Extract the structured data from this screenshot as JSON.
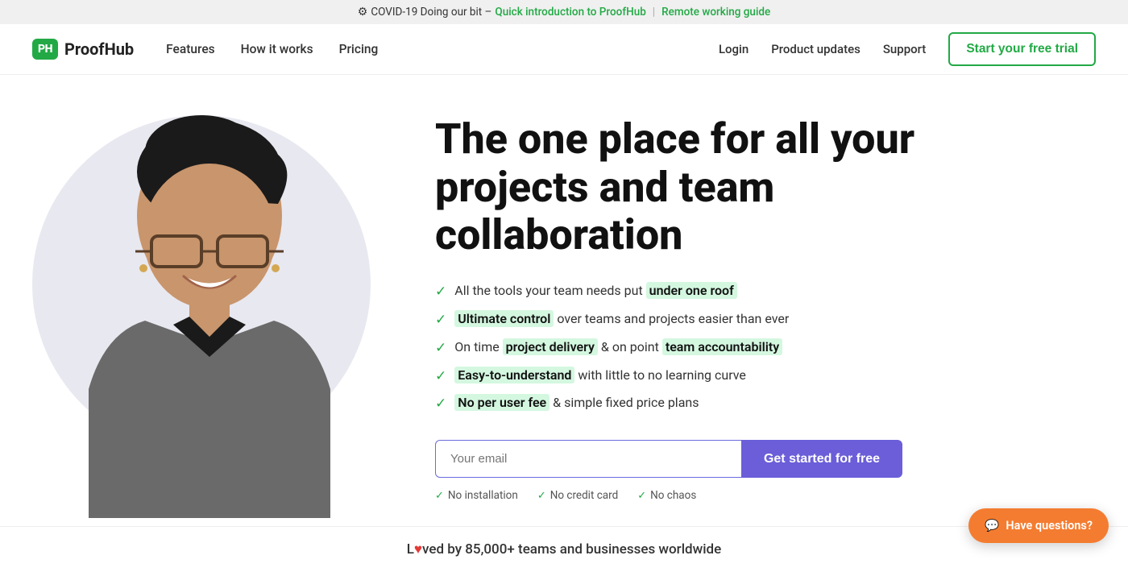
{
  "banner": {
    "gear": "⚙",
    "text": "COVID-19 Doing our bit –",
    "link1_text": "Quick introduction to ProofHub",
    "separator": "|",
    "link2_text": "Remote working guide"
  },
  "nav": {
    "logo_short": "PH",
    "logo_full": "ProofHub",
    "links": [
      {
        "label": "Features"
      },
      {
        "label": "How it works"
      },
      {
        "label": "Pricing"
      }
    ],
    "right_links": [
      {
        "label": "Login"
      },
      {
        "label": "Product updates"
      },
      {
        "label": "Support"
      }
    ],
    "cta": "Start your free trial"
  },
  "hero": {
    "title": "The one place for all your projects and team collaboration",
    "features": [
      {
        "text_before": "All the tools your team needs put ",
        "highlight": "under one roof",
        "text_after": ""
      },
      {
        "text_before": "",
        "highlight": "Ultimate control",
        "text_after": " over teams and projects easier than ever"
      },
      {
        "text_before": "On time ",
        "highlight": "project delivery",
        "text_mid": " & on point ",
        "highlight2": "team accountability",
        "text_after": ""
      },
      {
        "text_before": "",
        "highlight": "Easy-to-understand",
        "text_after": " with little to no learning curve"
      },
      {
        "text_before": "",
        "highlight": "No per user fee",
        "text_after": " & simple fixed price plans"
      }
    ],
    "email_placeholder": "Your email",
    "cta_button": "Get started for free",
    "no_items": [
      "No installation",
      "No credit card",
      "No chaos"
    ]
  },
  "loved_bar": {
    "text_before": "L",
    "heart": "♥",
    "text_after": "ved by 85,000+ teams and businesses worldwide"
  },
  "chat": {
    "icon": "💬",
    "label": "Have questions?"
  }
}
